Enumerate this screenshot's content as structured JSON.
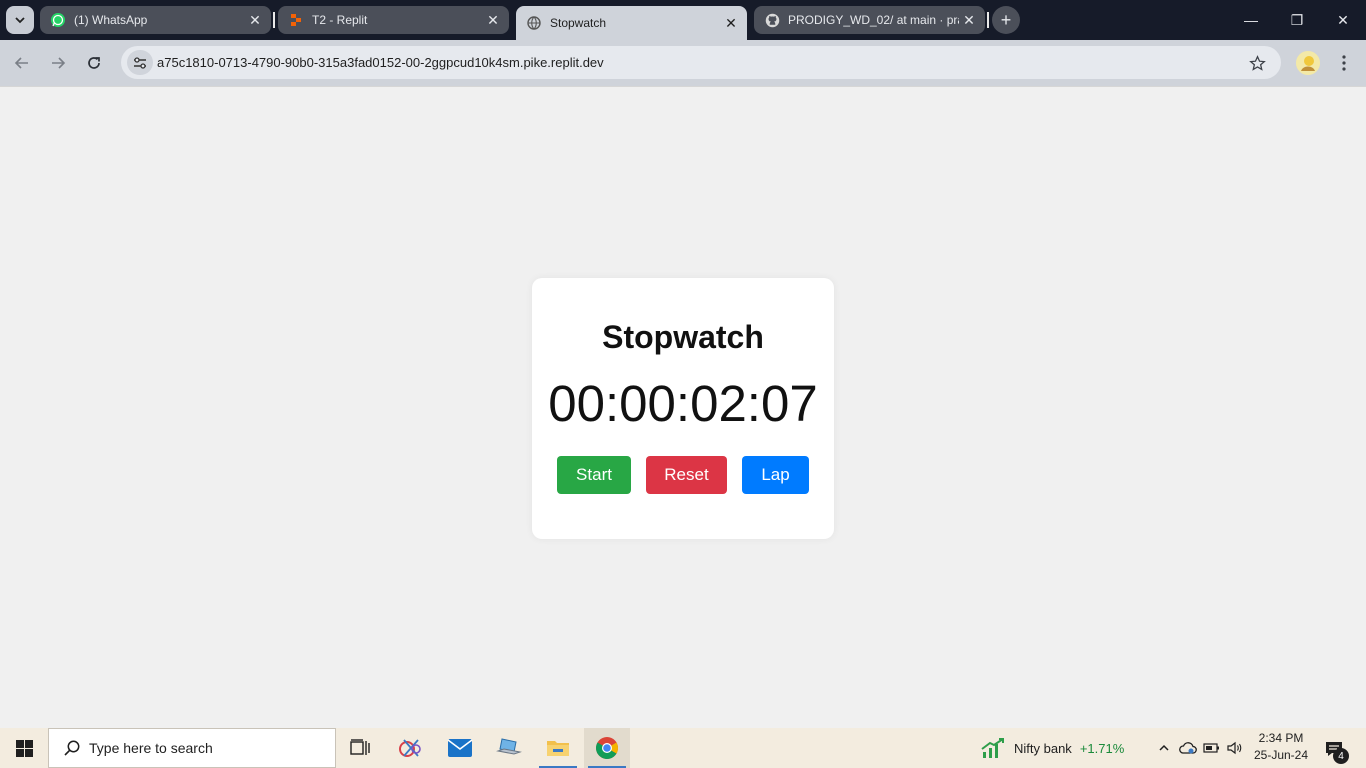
{
  "browser": {
    "tabs": [
      {
        "title": "(1) WhatsApp",
        "favicon": "whatsapp-icon",
        "active": false
      },
      {
        "title": "T2 - Replit",
        "favicon": "replit-icon",
        "active": false
      },
      {
        "title": "Stopwatch",
        "favicon": "globe-icon",
        "active": true
      },
      {
        "title": "PRODIGY_WD_02/ at main · pra",
        "favicon": "github-icon",
        "active": false
      }
    ],
    "new_tab_label": "+",
    "url": "a75c1810-0713-4790-90b0-315a3fad0152-00-2ggpcud10k4sm.pike.replit.dev",
    "window_controls": {
      "minimize": "—",
      "restore": "❐",
      "close": "✕"
    }
  },
  "page": {
    "title": "Stopwatch",
    "time": "00:00:02:07",
    "buttons": {
      "start": "Start",
      "reset": "Reset",
      "lap": "Lap"
    },
    "colors": {
      "start": "#28a745",
      "reset": "#dc3545",
      "lap": "#007bff"
    }
  },
  "taskbar": {
    "search_placeholder": "Type here to search",
    "widget": {
      "name": "Nifty bank",
      "change": "+1.71%"
    },
    "clock": {
      "time": "2:34 PM",
      "date": "25-Jun-24"
    },
    "notification_count": "4"
  }
}
